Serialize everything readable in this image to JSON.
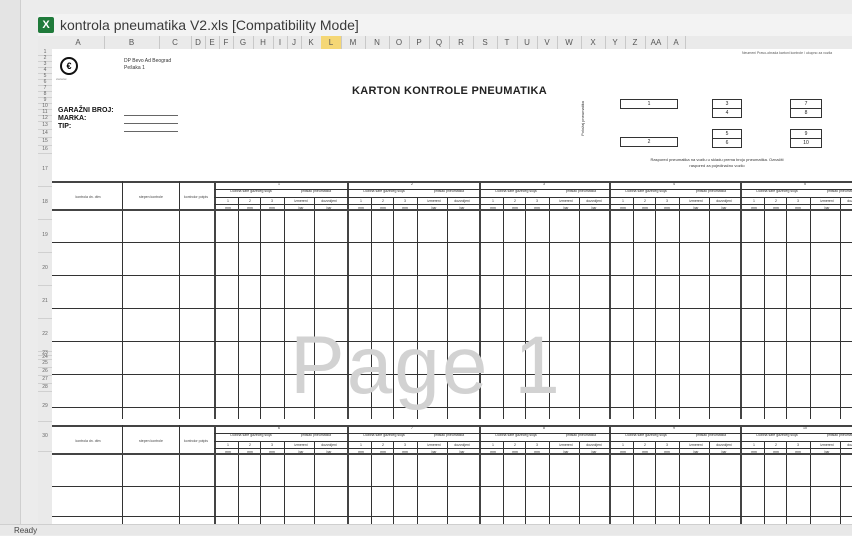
{
  "window": {
    "title": "kontrola pneumatika V2.xls  [Compatibility Mode]"
  },
  "columns": [
    "A",
    "B",
    "C",
    "D",
    "E",
    "F",
    "G",
    "H",
    "I",
    "J",
    "K",
    "L",
    "M",
    "N",
    "O",
    "P",
    "Q",
    "R",
    "S",
    "T",
    "U",
    "V",
    "W",
    "X",
    "Y",
    "Z",
    "AA",
    "A"
  ],
  "active_column": "L",
  "rows": [
    "1",
    "2",
    "3",
    "4",
    "5",
    "6",
    "7",
    "8",
    "9",
    "10",
    "11",
    "12",
    "13",
    "14",
    "15",
    "16",
    "17",
    "18",
    "19",
    "20",
    "21",
    "22",
    "23",
    "24",
    "25",
    "26",
    "27",
    "28",
    "29",
    "30"
  ],
  "sheet": {
    "logo_mark": "€",
    "logo_caption": "xxxxxxx",
    "company_line1": "DP Bevo Ad Beograd",
    "company_line2": "Pešaka 1",
    "top_right_note": "Neumeni Pravo-obrada kartoni kontrole / ukupno za vozila",
    "title": "KARTON KONTROLE PNEUMATIKA",
    "label_garage": "GARAŽNI BROJ:",
    "label_brand": "MARKA:",
    "label_type": "TIP:",
    "vertical_label": "Položaj pneumatika",
    "positions": [
      "1",
      "2",
      "3",
      "4",
      "5",
      "6",
      "7",
      "8",
      "9",
      "10"
    ],
    "note_line1": "Raspored pneumatika na vozilu u skladu prema broju pneumatika. Označiti",
    "note_line2": "raspored za pojedinačno vozilo",
    "col_date": "kontrola dn. dtm",
    "col_tread": "stepen kontrole",
    "col_signature": "kontrolor potpis",
    "group_depth": "Dubina šare gazećeg sloja",
    "group_pressure": "pritisak pneumatika",
    "sub_1": "1",
    "sub_2": "2",
    "sub_3": "3",
    "sub_pressure": "izmereni",
    "sub_required": "dozvoljeni",
    "unit_mm": "mm",
    "unit_bar": "bar",
    "group_numbers_top": [
      "1",
      "2",
      "3",
      "4",
      "5"
    ],
    "group_numbers_bottom": [
      "6",
      "7",
      "8",
      "9",
      "10"
    ]
  },
  "watermark": "Page 1",
  "status": "Ready"
}
